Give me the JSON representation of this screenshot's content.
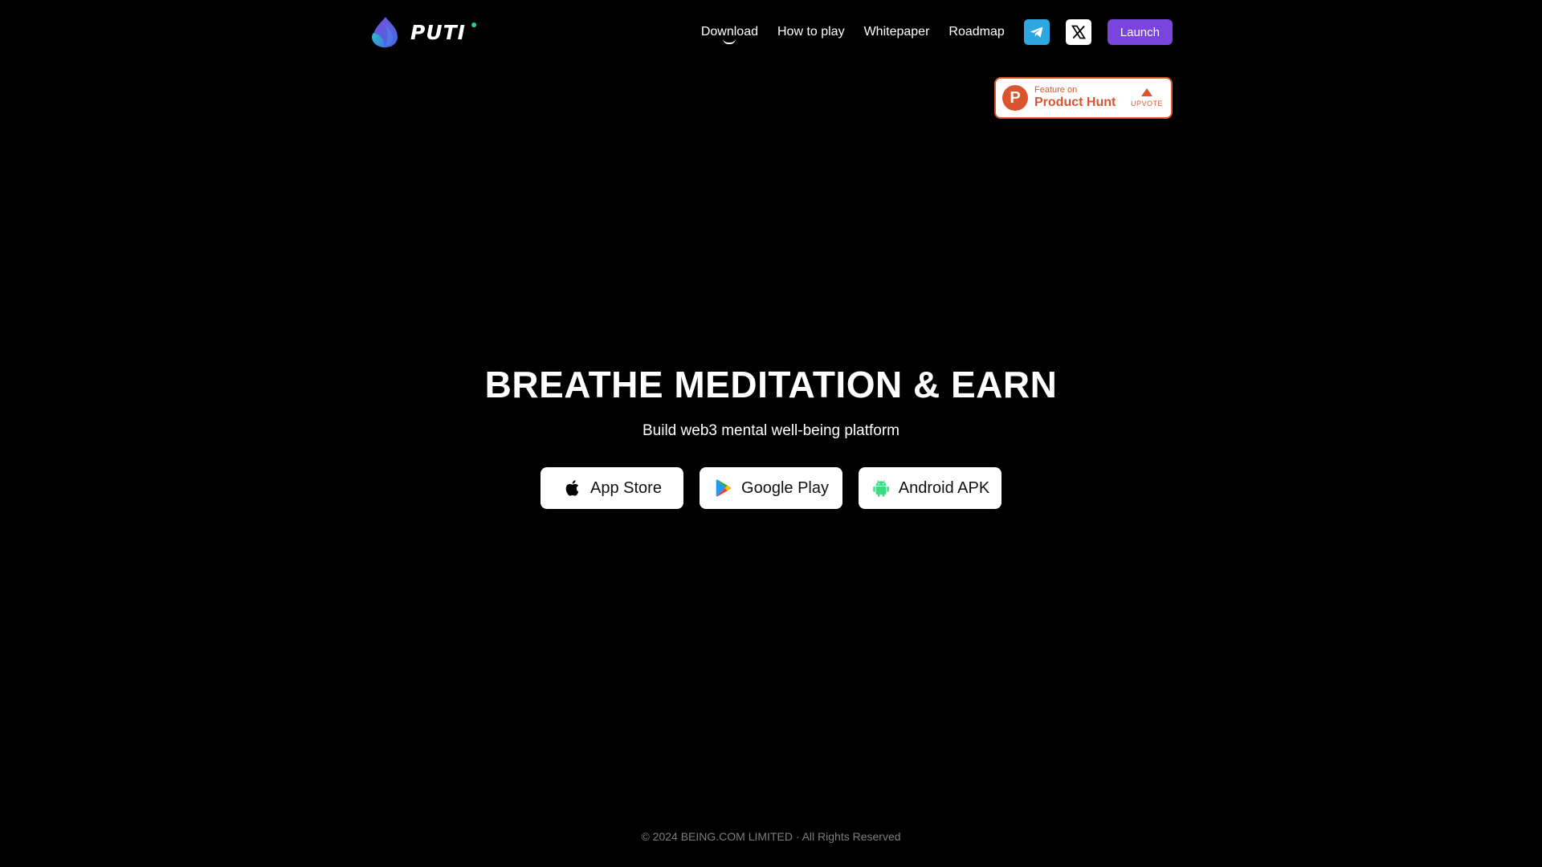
{
  "brand": {
    "name": "PUTI"
  },
  "nav": {
    "links": [
      "Download",
      "How to play",
      "Whitepaper",
      "Roadmap"
    ],
    "launch_label": "Launch"
  },
  "product_hunt": {
    "small_text": "Feature on",
    "big_text": "Product Hunt",
    "upvote_text": "UPVOTE",
    "logo_letter": "P"
  },
  "hero": {
    "title": "BREATHE MEDITATION & EARN",
    "subtitle": "Build web3 mental well-being platform",
    "buttons": [
      {
        "label": "App Store",
        "icon": "apple-icon"
      },
      {
        "label": "Google Play",
        "icon": "google-play-icon"
      },
      {
        "label": "Android APK",
        "icon": "android-icon"
      }
    ]
  },
  "footer": {
    "copyright": "© 2024 BEING.COM LIMITED · All Rights Reserved"
  },
  "colors": {
    "background": "#000000",
    "accent": "#7a45dc",
    "telegram": "#2ea6e0",
    "product_hunt": "#da552f"
  }
}
